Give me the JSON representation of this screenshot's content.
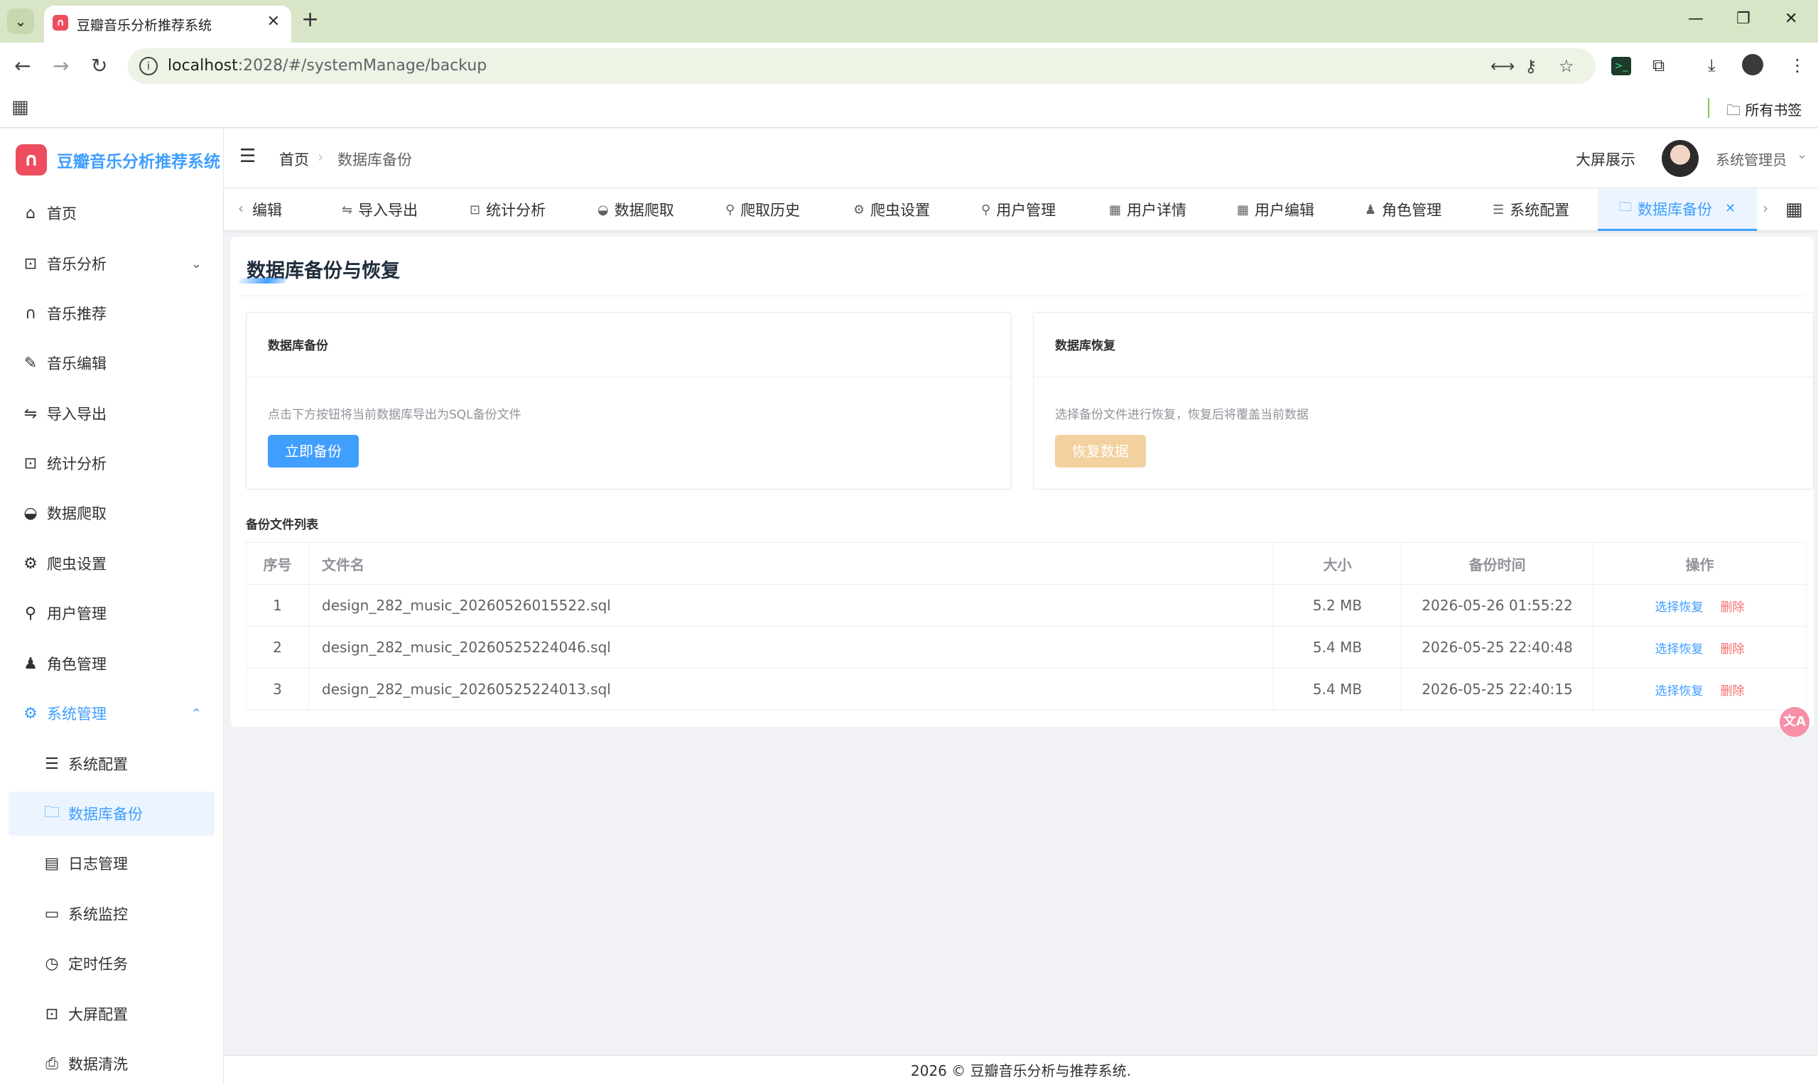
{
  "browser": {
    "tab_title": "豆瓣音乐分析推荐系统",
    "url_host": "localhost",
    "url_rest": ":2028/#/systemManage/backup",
    "bookmarks_all": "所有书签"
  },
  "app": {
    "title": "豆瓣音乐分析推荐系统",
    "brand_color": "#409eff"
  },
  "sidebar": {
    "items": [
      {
        "label": "首页",
        "icon": "home-icon"
      },
      {
        "label": "音乐分析",
        "icon": "presentation-icon"
      },
      {
        "label": "音乐推荐",
        "icon": "headphones-icon"
      },
      {
        "label": "音乐编辑",
        "icon": "edit-icon"
      },
      {
        "label": "导入导出",
        "icon": "switch-icon"
      },
      {
        "label": "统计分析",
        "icon": "presentation-icon"
      },
      {
        "label": "数据爬取",
        "icon": "bowl-icon"
      },
      {
        "label": "爬虫设置",
        "icon": "gear-icon"
      },
      {
        "label": "用户管理",
        "icon": "user-icon"
      },
      {
        "label": "角色管理",
        "icon": "stamp-icon"
      },
      {
        "label": "系统管理",
        "icon": "gear-icon"
      },
      {
        "label": "系统配置",
        "icon": "sliders-icon"
      },
      {
        "label": "数据库备份",
        "icon": "folder-icon"
      },
      {
        "label": "日志管理",
        "icon": "document-icon"
      },
      {
        "label": "系统监控",
        "icon": "monitor-icon"
      },
      {
        "label": "定时任务",
        "icon": "timer-icon"
      },
      {
        "label": "大屏配置",
        "icon": "screen-icon"
      },
      {
        "label": "数据清洗",
        "icon": "printer-icon"
      }
    ]
  },
  "header": {
    "breadcrumb_home": "首页",
    "breadcrumb_current": "数据库备份",
    "big_screen": "大屏展示",
    "username": "系统管理员"
  },
  "tags": [
    {
      "label": "编辑",
      "icon": "edit-icon"
    },
    {
      "label": "导入导出",
      "icon": "switch-icon"
    },
    {
      "label": "统计分析",
      "icon": "presentation-icon"
    },
    {
      "label": "数据爬取",
      "icon": "bowl-icon"
    },
    {
      "label": "爬取历史",
      "icon": "user-icon"
    },
    {
      "label": "爬虫设置",
      "icon": "gear-icon"
    },
    {
      "label": "用户管理",
      "icon": "user-icon"
    },
    {
      "label": "用户详情",
      "icon": "grid-icon"
    },
    {
      "label": "用户编辑",
      "icon": "grid-icon"
    },
    {
      "label": "角色管理",
      "icon": "stamp-icon"
    },
    {
      "label": "系统配置",
      "icon": "sliders-icon"
    },
    {
      "label": "数据库备份",
      "icon": "folder-icon"
    }
  ],
  "page": {
    "title": "数据库备份与恢复",
    "backup_panel": {
      "title": "数据库备份",
      "desc": "点击下方按钮将当前数据库导出为SQL备份文件",
      "button": "立即备份"
    },
    "restore_panel": {
      "title": "数据库恢复",
      "desc": "选择备份文件进行恢复，恢复后将覆盖当前数据",
      "button": "恢复数据"
    },
    "list_title": "备份文件列表",
    "columns": [
      "序号",
      "文件名",
      "大小",
      "备份时间",
      "操作"
    ],
    "rows": [
      {
        "idx": "1",
        "name": "design_282_music_20260526015522.sql",
        "size": "5.2 MB",
        "time": "2026-05-26 01:55:22"
      },
      {
        "idx": "2",
        "name": "design_282_music_20260525224046.sql",
        "size": "5.4 MB",
        "time": "2026-05-25 22:40:48"
      },
      {
        "idx": "3",
        "name": "design_282_music_20260525224013.sql",
        "size": "5.4 MB",
        "time": "2026-05-25 22:40:15"
      }
    ],
    "op_restore": "选择恢复",
    "op_delete": "删除"
  },
  "footer": "2026 © 豆瓣音乐分析与推荐系统."
}
